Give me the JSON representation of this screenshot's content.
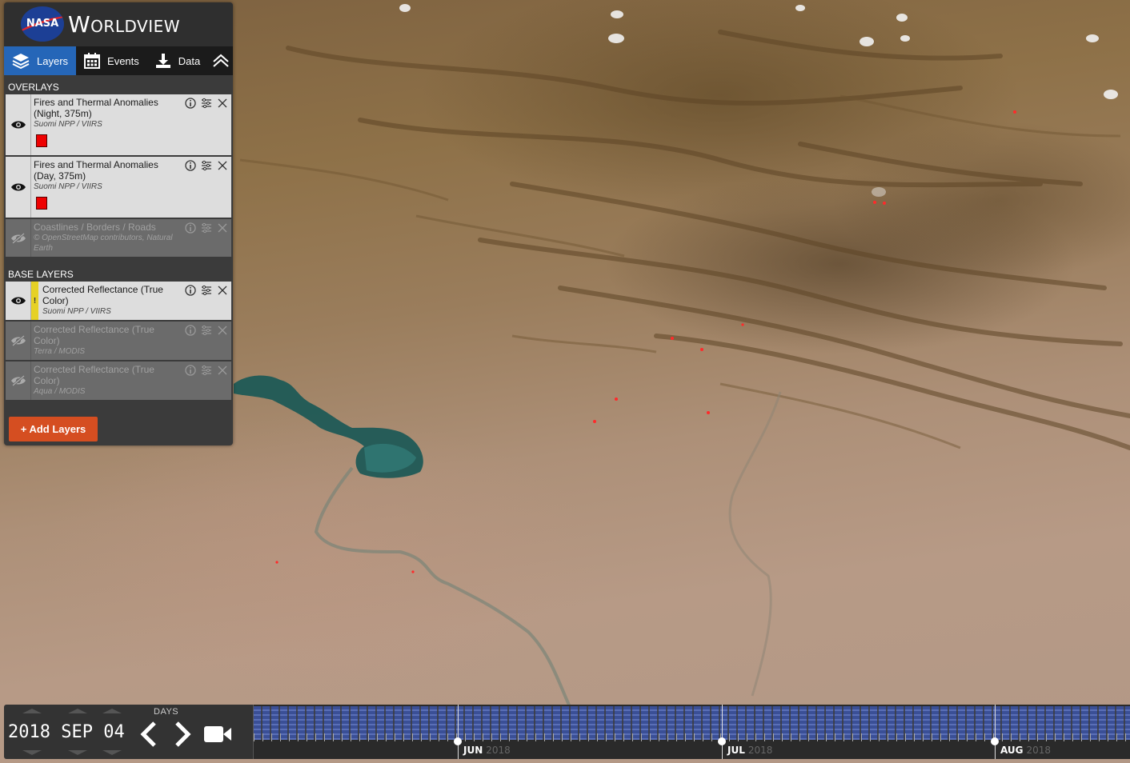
{
  "app": {
    "brand_logo_text": "NASA",
    "title": "Worldview"
  },
  "tabs": [
    {
      "label": "Layers",
      "icon": "layers-icon",
      "active": true
    },
    {
      "label": "Events",
      "icon": "calendar-icon",
      "active": false
    },
    {
      "label": "Data",
      "icon": "download-icon",
      "active": false
    }
  ],
  "overlays": {
    "label": "OVERLAYS",
    "items": [
      {
        "title": "Fires and Thermal Anomalies (Night, 375m)",
        "source": "Suomi NPP / VIIRS",
        "visible": true,
        "swatch_color": "#ff0000"
      },
      {
        "title": "Fires and Thermal Anomalies (Day, 375m)",
        "source": "Suomi NPP / VIIRS",
        "visible": true,
        "swatch_color": "#ff0000"
      },
      {
        "title": "Coastlines / Borders / Roads",
        "source": "© OpenStreetMap contributors, Natural Earth",
        "visible": false
      }
    ]
  },
  "base_layers": {
    "label": "BASE LAYERS",
    "items": [
      {
        "title": "Corrected Reflectance (True Color)",
        "source": "Suomi NPP / VIIRS",
        "visible": true,
        "warning": "!"
      },
      {
        "title": "Corrected Reflectance (True Color)",
        "source": "Terra / MODIS",
        "visible": false
      },
      {
        "title": "Corrected Reflectance (True Color)",
        "source": "Aqua / MODIS",
        "visible": false
      }
    ]
  },
  "add_layers_label": "+ Add Layers",
  "timeline": {
    "date_year": "2018",
    "date_month": "SEP",
    "date_day": "04",
    "interval_label": "DAYS",
    "months": [
      {
        "label": "JUN",
        "year": "2018"
      },
      {
        "label": "JUL",
        "year": "2018"
      },
      {
        "label": "AUG",
        "year": "2018"
      }
    ]
  },
  "colors": {
    "active_tab": "#2566b8",
    "add_layers": "#d54e21",
    "warning": "#e6d125",
    "fire": "#ff0000"
  }
}
